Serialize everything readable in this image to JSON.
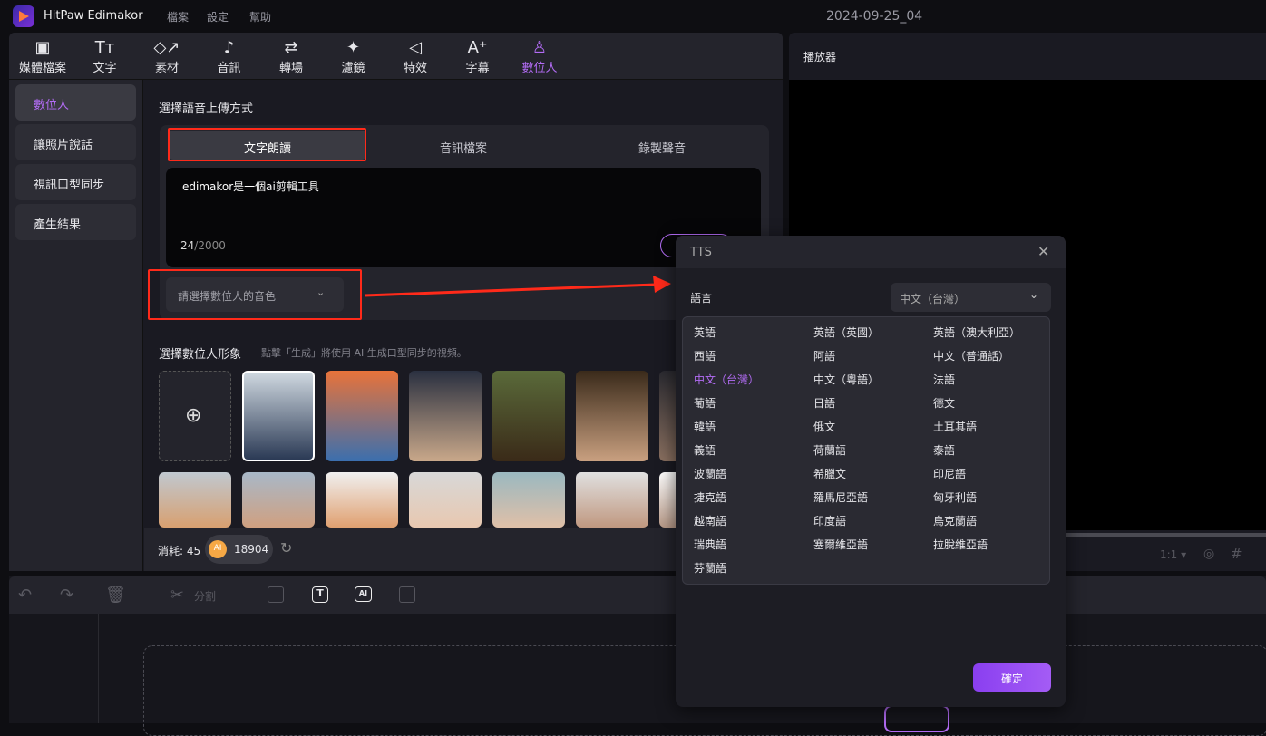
{
  "app": {
    "name": "HitPaw Edimakor",
    "menu": [
      "檔案",
      "設定",
      "幫助"
    ],
    "document_title": "2024-09-25_04"
  },
  "tools": [
    {
      "label": "媒體檔案",
      "icon": "media-icon"
    },
    {
      "label": "文字",
      "icon": "text-icon"
    },
    {
      "label": "素材",
      "icon": "elements-icon"
    },
    {
      "label": "音訊",
      "icon": "audio-icon"
    },
    {
      "label": "轉場",
      "icon": "transition-icon"
    },
    {
      "label": "濾鏡",
      "icon": "filter-icon"
    },
    {
      "label": "特效",
      "icon": "effects-icon"
    },
    {
      "label": "字幕",
      "icon": "subtitle-icon"
    },
    {
      "label": "數位人",
      "icon": "avatar-icon",
      "active": true
    }
  ],
  "sidebar": {
    "items": [
      {
        "label": "數位人",
        "active": true
      },
      {
        "label": "讓照片說話"
      },
      {
        "label": "視訊口型同步"
      },
      {
        "label": "產生結果"
      }
    ]
  },
  "upload": {
    "title": "選擇語音上傳方式",
    "tabs": [
      "文字朗讀",
      "音訊檔案",
      "錄製聲音"
    ],
    "active_tab": "文字朗讀",
    "text_value": "edimakor是一個ai剪輯工具",
    "char_count": "24",
    "char_limit": "/2000",
    "voice_placeholder": "請選擇數位人的音色"
  },
  "avatars": {
    "title": "選擇數位人形象",
    "hint": "點擊「生成」將使用 AI 生成口型同步的視頻。"
  },
  "footer": {
    "cost_label": "消耗: 45",
    "coin_badge": "AI",
    "credits": "18904"
  },
  "player": {
    "title": "播放器",
    "ratio": "1:1"
  },
  "timeline": {
    "split_label": "分割"
  },
  "tts": {
    "title": "TTS",
    "language_label": "語言",
    "selected_language": "中文（台灣）",
    "languages": [
      "英語",
      "英語（英國）",
      "英語（澳大利亞）",
      "西語",
      "阿語",
      "中文（普通話）",
      "中文（台灣）",
      "中文（粵語）",
      "法語",
      "葡語",
      "日語",
      "德文",
      "韓語",
      "俄文",
      "土耳其語",
      "義語",
      "荷蘭語",
      "泰語",
      "波蘭語",
      "希臘文",
      "印尼語",
      "捷克語",
      "羅馬尼亞語",
      "匈牙利語",
      "越南語",
      "印度語",
      "烏克蘭語",
      "瑞典語",
      "塞爾維亞語",
      "拉脫維亞語",
      "芬蘭語"
    ],
    "confirm_label": "確定"
  },
  "colors": {
    "accent": "#b36cf5",
    "annotation": "#ff2a1a"
  }
}
